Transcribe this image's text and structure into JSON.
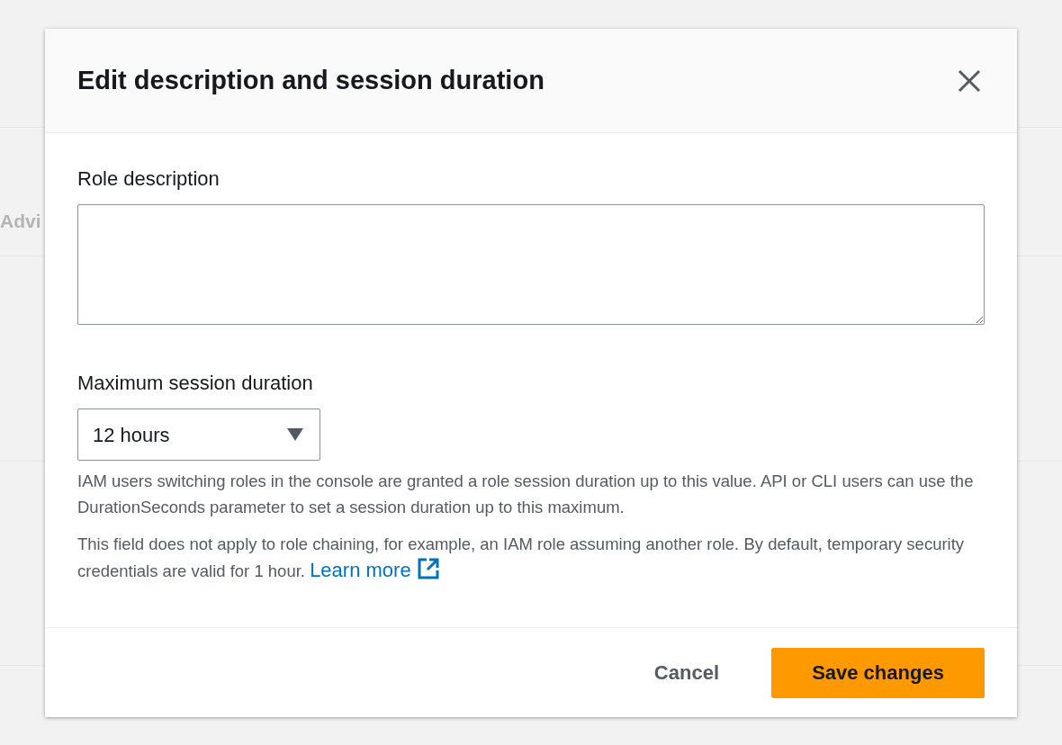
{
  "background": {
    "text": "Advi"
  },
  "modal": {
    "title": "Edit description and session duration",
    "fields": [
      {
        "kind": "textarea",
        "label": "Role description"
      },
      {
        "kind": "select",
        "label": "Maximum session duration",
        "value": "12 hours"
      }
    ],
    "help": [
      "IAM users switching roles in the console are granted a role session duration up to this value. API or CLI users can use the DurationSeconds parameter to set a session duration up to this maximum.",
      "This field does not apply to role chaining, for example, an IAM role assuming another role. By default, temporary security credentials are valid for 1 hour."
    ],
    "link": "Learn more",
    "buttons": [
      {
        "kind": "link",
        "label": "Cancel"
      },
      {
        "kind": "primary",
        "label": "Save changes"
      }
    ]
  }
}
